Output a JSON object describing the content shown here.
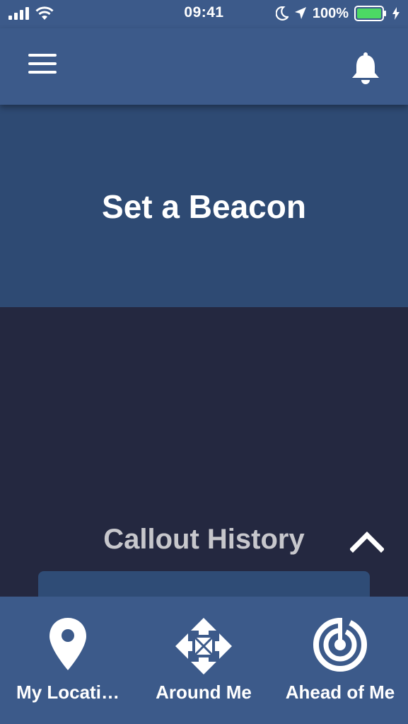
{
  "status_bar": {
    "time": "09:41",
    "battery": "100%",
    "icons": [
      "signal-icon",
      "wifi-icon",
      "moon-icon",
      "location-arrow-icon",
      "battery-icon",
      "charging-bolt-icon"
    ]
  },
  "nav_bar": {
    "menu_icon": "hamburger-menu-icon",
    "notification_icon": "bell-icon"
  },
  "beacon": {
    "label": "Set a Beacon"
  },
  "callout_history": {
    "title": "Callout History",
    "toggle_icon": "chevron-up-icon"
  },
  "tabs": [
    {
      "label": "My Locati…",
      "icon": "map-pin-icon"
    },
    {
      "label": "Around Me",
      "icon": "four-arrows-icon"
    },
    {
      "label": "Ahead of Me",
      "icon": "radar-icon"
    }
  ],
  "colors": {
    "header": "#3c5a8a",
    "beacon_panel": "#2e4a73",
    "background": "#242840",
    "battery_fill": "#4cd964"
  }
}
